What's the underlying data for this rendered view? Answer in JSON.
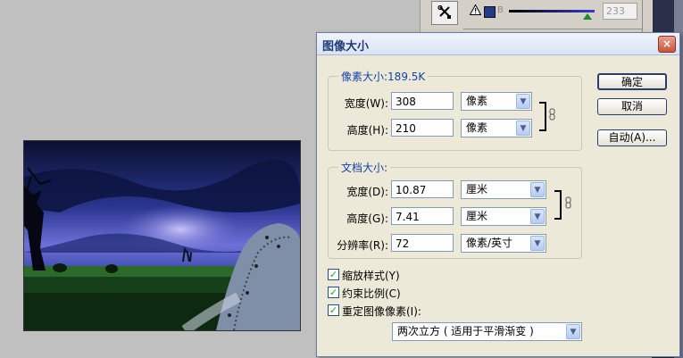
{
  "toolbar_fragment": {
    "tool_icon": "wrench-icon",
    "warning_icon": "warning-icon",
    "channel_letter": "B",
    "value": "233",
    "swatch_color": "#223a8a",
    "slider_value": 233,
    "slider_max": 255
  },
  "dialog": {
    "title": "图像大小",
    "close_icon": "close-icon",
    "pixel_dimensions": {
      "legend": "像素大小:189.5K",
      "width_label": "宽度(W):",
      "width_value": "308",
      "width_unit": "像素",
      "height_label": "高度(H):",
      "height_value": "210",
      "height_unit": "像素"
    },
    "document_size": {
      "legend": "文档大小:",
      "width_label": "宽度(D):",
      "width_value": "10.87",
      "width_unit": "厘米",
      "height_label": "高度(G):",
      "height_value": "7.41",
      "height_unit": "厘米",
      "resolution_label": "分辨率(R):",
      "resolution_value": "72",
      "resolution_unit": "像素/英寸"
    },
    "options": {
      "scale_styles": "缩放样式(Y)",
      "constrain_proportions": "约束比例(C)",
      "resample_image": "重定图像像素(I):",
      "resample_method": "两次立方 ( 适用于平滑渐变 )"
    },
    "buttons": {
      "ok": "确定",
      "cancel": "取消",
      "auto": "自动(A)..."
    }
  }
}
